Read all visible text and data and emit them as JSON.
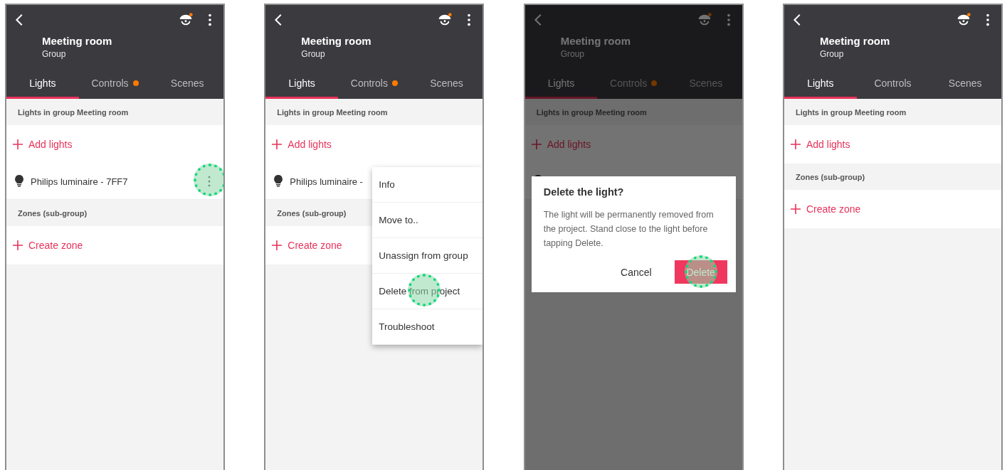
{
  "screens": [
    {
      "title": "Meeting room",
      "subtitle": "Group",
      "tabs": [
        {
          "label": "Lights",
          "selected": true,
          "badge": false
        },
        {
          "label": "Controls",
          "selected": false,
          "badge": true
        },
        {
          "label": "Scenes",
          "selected": false,
          "badge": false
        }
      ],
      "sections": [
        {
          "header": "Lights in group Meeting room",
          "items": [
            {
              "kind": "action",
              "label": "Add lights"
            },
            {
              "kind": "light",
              "name": "Philips luminaire - 7FF7",
              "tapped": true
            }
          ]
        },
        {
          "header": "Zones (sub-group)",
          "items": [
            {
              "kind": "action",
              "label": "Create zone"
            }
          ]
        }
      ]
    },
    {
      "title": "Meeting room",
      "subtitle": "Group",
      "tabs": [
        {
          "label": "Lights",
          "selected": true,
          "badge": false
        },
        {
          "label": "Controls",
          "selected": false,
          "badge": true
        },
        {
          "label": "Scenes",
          "selected": false,
          "badge": false
        }
      ],
      "sections": [
        {
          "header": "Lights in group Meeting room",
          "items": [
            {
              "kind": "action",
              "label": "Add lights"
            },
            {
              "kind": "light",
              "name": "Philips luminaire -"
            }
          ]
        },
        {
          "header": "Zones (sub-group)",
          "items": [
            {
              "kind": "action",
              "label": "Create zone"
            }
          ]
        }
      ],
      "menu": [
        {
          "label": "Info",
          "tapped": false
        },
        {
          "label": "Move to..",
          "tapped": false
        },
        {
          "label": "Unassign from group",
          "tapped": false
        },
        {
          "label": "Delete from project",
          "tapped": true
        },
        {
          "label": "Troubleshoot",
          "tapped": false
        }
      ]
    },
    {
      "title": "Meeting room",
      "subtitle": "Group",
      "dimmed": true,
      "tabs": [
        {
          "label": "Lights",
          "selected": true,
          "badge": false
        },
        {
          "label": "Controls",
          "selected": false,
          "badge": true
        },
        {
          "label": "Scenes",
          "selected": false,
          "badge": false
        }
      ],
      "sections": [
        {
          "header": "Lights in group Meeting room",
          "items": [
            {
              "kind": "action",
              "label": "Add lights"
            },
            {
              "kind": "light"
            }
          ]
        }
      ],
      "dialog": {
        "title": "Delete the light?",
        "message": "The light will be permanently removed from the project. Stand close to the light before tapping Delete.",
        "buttons": [
          {
            "kind": "text",
            "label": "Cancel",
            "tapped": false
          },
          {
            "kind": "primary",
            "label": "Delete",
            "tapped": true
          }
        ]
      }
    },
    {
      "title": "Meeting room",
      "subtitle": "Group",
      "tabs": [
        {
          "label": "Lights",
          "selected": true,
          "badge": false
        },
        {
          "label": "Controls",
          "selected": false,
          "badge": false
        },
        {
          "label": "Scenes",
          "selected": false,
          "badge": false
        }
      ],
      "sections": [
        {
          "header": "Lights in group Meeting room",
          "items": [
            {
              "kind": "action",
              "label": "Add lights"
            }
          ]
        },
        {
          "header": "Zones (sub-group)",
          "items": [
            {
              "kind": "action",
              "label": "Create zone"
            }
          ]
        }
      ]
    }
  ]
}
